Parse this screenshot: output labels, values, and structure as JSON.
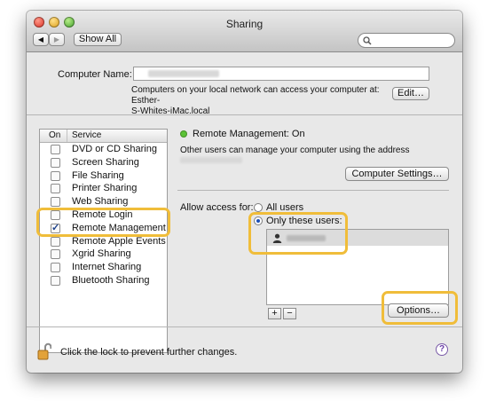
{
  "window": {
    "title": "Sharing"
  },
  "toolbar": {
    "show_all_label": "Show All",
    "back_icon": "◀",
    "forward_icon": "▶"
  },
  "computer_name": {
    "label": "Computer Name:",
    "description": "Computers on your local network can access your computer at: Esther-S-Whites-iMac.local",
    "description_line1": "Computers on your local network can access your computer at: Esther-",
    "description_line2": "S-Whites-iMac.local",
    "edit_label": "Edit…"
  },
  "services": {
    "col_on": "On",
    "col_service": "Service",
    "items": [
      {
        "name": "DVD or CD Sharing",
        "checked": false
      },
      {
        "name": "Screen Sharing",
        "checked": false
      },
      {
        "name": "File Sharing",
        "checked": false
      },
      {
        "name": "Printer Sharing",
        "checked": false
      },
      {
        "name": "Web Sharing",
        "checked": false
      },
      {
        "name": "Remote Login",
        "checked": false
      },
      {
        "name": "Remote Management",
        "checked": true
      },
      {
        "name": "Remote Apple Events",
        "checked": false
      },
      {
        "name": "Xgrid Sharing",
        "checked": false
      },
      {
        "name": "Internet Sharing",
        "checked": false
      },
      {
        "name": "Bluetooth Sharing",
        "checked": false
      }
    ]
  },
  "status": {
    "title": "Remote Management: On",
    "description": "Other users can manage your computer using the address",
    "color": "#5bc236"
  },
  "computer_settings_label": "Computer Settings…",
  "access": {
    "label": "Allow access for:",
    "all_users": "All users",
    "only_these": "Only these users:",
    "selected": "only_these"
  },
  "user_controls": {
    "add": "+",
    "remove": "−"
  },
  "options_label": "Options…",
  "lock_text": "Click the lock to prevent further changes.",
  "help_label": "?",
  "highlight_color": "#f0bd3a"
}
